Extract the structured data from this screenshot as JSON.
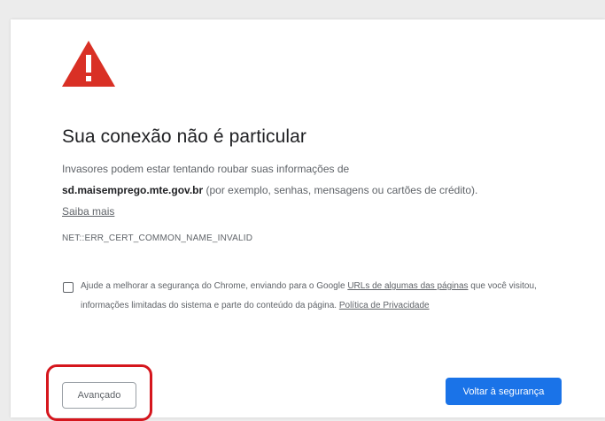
{
  "interstitial": {
    "title": "Sua conexão não é particular",
    "message_intro": "Invasores podem estar tentando roubar suas informações de",
    "domain": "sd.maisemprego.mte.gov.br",
    "message_detail": " (por exemplo, senhas, mensagens ou cartões de crédito).",
    "learn_more": "Saiba mais",
    "error_code": "NET::ERR_CERT_COMMON_NAME_INVALID",
    "optin": {
      "text_before": "Ajude a melhorar a segurança do Chrome, enviando para o Google ",
      "urls_link": "URLs de algumas das páginas",
      "text_after": " que você visitou, informações limitadas do sistema e parte do conteúdo da página. ",
      "privacy_link": "Política de Privacidade",
      "checked": false
    },
    "buttons": {
      "advanced": "Avançado",
      "back_to_safety": "Voltar à segurança"
    }
  },
  "colors": {
    "warning_icon": "#d93025",
    "primary_button": "#1a73e8",
    "highlight_box": "#d5161d",
    "title_text": "#202124",
    "body_text": "#5f6368"
  },
  "icons": {
    "warning": "warning-triangle-icon"
  }
}
